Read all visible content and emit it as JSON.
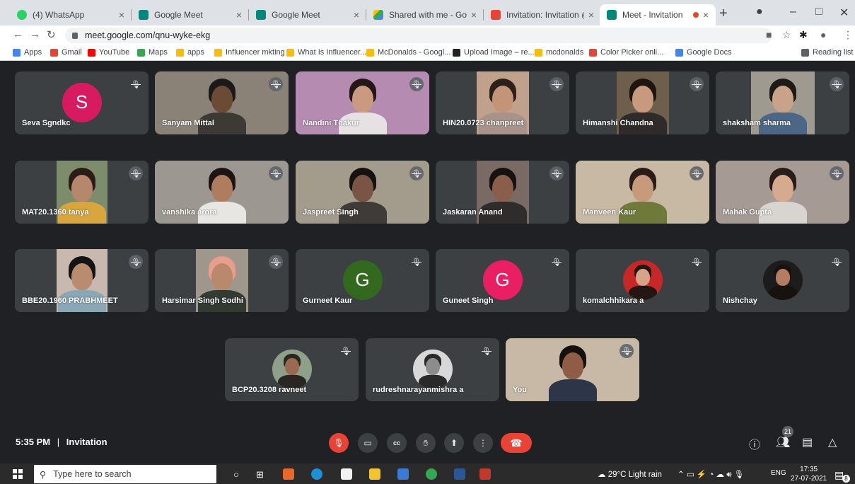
{
  "browser": {
    "tabs": [
      {
        "label": "(4) WhatsApp",
        "close": "×",
        "color": "#25d366",
        "active": false
      },
      {
        "label": "Google Meet",
        "close": "×",
        "color": "#00897b",
        "active": false
      },
      {
        "label": "Google Meet",
        "close": "×",
        "color": "#00897b",
        "active": false
      },
      {
        "label": "Shared with me - Google D",
        "close": "×",
        "color": "#fbbc04",
        "active": false
      },
      {
        "label": "Invitation: Invitation @ Tue",
        "close": "×",
        "color": "#ea4335",
        "active": false
      },
      {
        "label": "Meet - Invitation",
        "close": "×",
        "color": "#00897b",
        "active": true
      }
    ],
    "new_tab": "+",
    "url": "meet.google.com/qnu-wyke-ekg",
    "bookmarks": [
      {
        "label": "Apps",
        "color": "#4285f4"
      },
      {
        "label": "Gmail",
        "color": "#ea4335"
      },
      {
        "label": "YouTube",
        "color": "#ff0000"
      },
      {
        "label": "Maps",
        "color": "#34a853"
      },
      {
        "label": "apps",
        "color": "#fbbc04"
      },
      {
        "label": "Influencer mkting",
        "color": "#fbbc04"
      },
      {
        "label": "What Is Influencer...",
        "color": "#fbbc04"
      },
      {
        "label": "McDonalds - Googl...",
        "color": "#fbbc04"
      },
      {
        "label": "Upload Image – re...",
        "color": "#202124"
      },
      {
        "label": "mcdonalds",
        "color": "#fbbc04"
      },
      {
        "label": "Color Picker onli...",
        "color": "#ea4335"
      },
      {
        "label": "Google Docs",
        "color": "#4285f4"
      }
    ],
    "reading_list": "Reading list"
  },
  "meet": {
    "participants": [
      {
        "name": "Seva Sgndkc",
        "type": "letter",
        "letter": "S",
        "color": "#d81b60"
      },
      {
        "name": "Sanyam Mittal",
        "type": "video",
        "bg": "#8a8276",
        "skin": "#6b4a36",
        "hair": "#1c1a18",
        "shirt": "#3d3a35"
      },
      {
        "name": "Nandini Thakur",
        "type": "video",
        "bg": "#b58bb2",
        "skin": "#c99a80",
        "hair": "#241816",
        "shirt": "#e6e2e4"
      },
      {
        "name": "HIN20.0723 chanpreet",
        "type": "video",
        "bg": "#c0a28c",
        "skin": "#c49478",
        "hair": "#2d1f1a",
        "shirt": "#a8928a"
      },
      {
        "name": "Himanshi Chandna",
        "type": "video",
        "bg": "#6e5f4c",
        "skin": "#c79a7e",
        "hair": "#1e1512",
        "shirt": "#2f2b2a"
      },
      {
        "name": "shaksham sharma",
        "type": "video",
        "bg": "#9f9a90",
        "skin": "#c9a389",
        "hair": "#1e1a18",
        "shirt": "#4c6688"
      },
      {
        "name": "MAT20.1360 tanya",
        "type": "video",
        "bg": "#7d8d6c",
        "skin": "#b5876c",
        "hair": "#2a1d18",
        "shirt": "#d9a53d"
      },
      {
        "name": "vanshika arora",
        "type": "video",
        "bg": "#9c9790",
        "skin": "#b07c60",
        "hair": "#1c1512",
        "shirt": "#e8e6e2"
      },
      {
        "name": "Jaspreet Singh",
        "type": "video",
        "bg": "#a39b8c",
        "skin": "#7a5444",
        "hair": "#151312",
        "shirt": "#3e3b38"
      },
      {
        "name": "Jaskaran Anand",
        "type": "video",
        "bg": "#7a6a66",
        "skin": "#8a5e4a",
        "hair": "#16120f",
        "shirt": "#2f2d2c"
      },
      {
        "name": "Manveen Kaur",
        "type": "video",
        "bg": "#c7b9a3",
        "skin": "#c79a7b",
        "hair": "#2a1c16",
        "shirt": "#6f7a3a"
      },
      {
        "name": "Mahak Gupta",
        "type": "video",
        "bg": "#a59b94",
        "skin": "#d6aa8e",
        "hair": "#2a1d19",
        "shirt": "#d8d5d0"
      },
      {
        "name": "BBE20.1960 PRABHMEET",
        "type": "video",
        "bg": "#c9b8ae",
        "skin": "#b98c70",
        "hair": "#151414",
        "shirt": "#8aa7b6"
      },
      {
        "name": "Harsimar Singh Sodhi",
        "type": "video",
        "bg": "#9f978b",
        "skin": "#b9896d",
        "hair": "#e79e8a",
        "shirt": "#323a32"
      },
      {
        "name": "Gurneet Kaur",
        "type": "letter",
        "letter": "G",
        "color": "#33691e"
      },
      {
        "name": "Guneet Singh",
        "type": "letter",
        "letter": "G",
        "color": "#e91e63"
      },
      {
        "name": "komalchhikara a",
        "type": "photo",
        "bg": "#c62828",
        "skin": "#d7a487",
        "hair": "#241613"
      },
      {
        "name": "Nishchay",
        "type": "photo",
        "bg": "#1c1c1c",
        "skin": "#b47c62",
        "hair": "#171210"
      },
      {
        "name": "BCP20.3208 ravneet",
        "type": "photo",
        "bg": "#8ea08a",
        "skin": "#9a6a50",
        "hair": "#2a2622"
      },
      {
        "name": "rudreshnarayanmishra a",
        "type": "photo",
        "bg": "#d8d8d8",
        "skin": "#8c8c8c",
        "hair": "#2a2a2a"
      },
      {
        "name": "You",
        "type": "video",
        "bg": "#c7b9a6",
        "skin": "#8f5d45",
        "hair": "#15110f",
        "shirt": "#2d3648"
      }
    ],
    "time": "5:35 PM",
    "separator": "|",
    "meeting_title": "Invitation",
    "participant_count": "21"
  },
  "taskbar": {
    "search_placeholder": "Type here to search",
    "weather": "29°C  Light rain",
    "lang": "ENG",
    "clock_time": "17:35",
    "clock_date": "27-07-2021",
    "notif_count": "8"
  }
}
